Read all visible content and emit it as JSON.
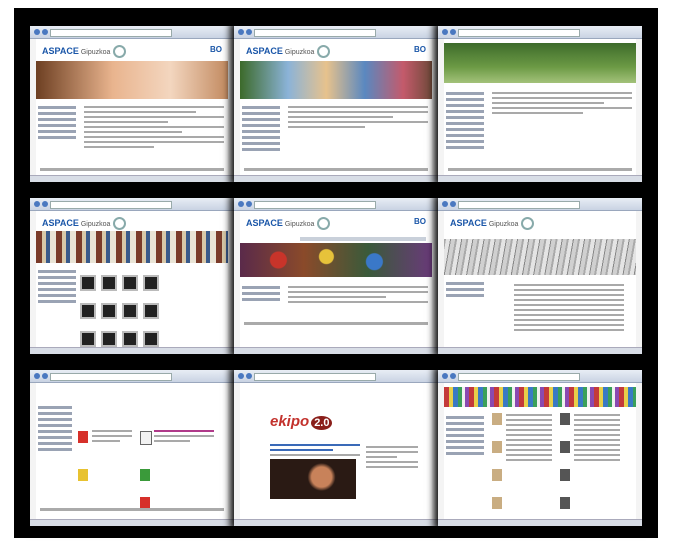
{
  "collage": {
    "tiles": [
      {
        "logo": "ASPACE",
        "logo_sub": "Gipuzkoa",
        "bo": "BO"
      },
      {
        "logo": "ASPACE",
        "logo_sub": "Gipuzkoa",
        "bo": "BO"
      },
      {
        "logo": "",
        "logo_sub": "",
        "bo": ""
      },
      {
        "logo": "ASPACE",
        "logo_sub": "Gipuzkoa",
        "bo": ""
      },
      {
        "logo": "ASPACE",
        "logo_sub": "Gipuzkoa",
        "bo": "BO"
      },
      {
        "logo": "ASPACE",
        "logo_sub": "Gipuzkoa",
        "bo": ""
      },
      {
        "logo": "",
        "logo_sub": "",
        "bo": ""
      },
      {
        "logo": "ekipo",
        "logo_sub": "2.0",
        "bo": ""
      },
      {
        "logo": "",
        "logo_sub": "",
        "bo": ""
      }
    ]
  },
  "colors": {
    "frame": "#000000",
    "accent": "#1a56a8",
    "ekipo_red": "#c3322d"
  }
}
